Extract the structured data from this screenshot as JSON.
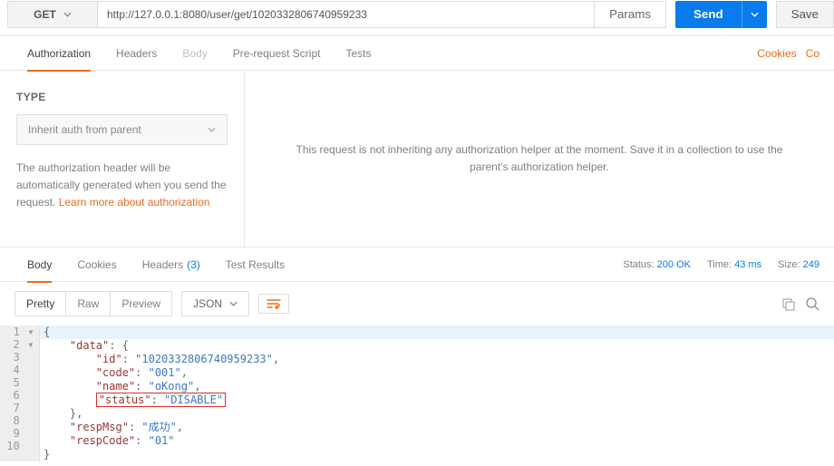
{
  "request": {
    "method": "GET",
    "url": "http://127.0.0.1:8080/user/get/1020332806740959233",
    "params_label": "Params",
    "send_label": "Send",
    "save_label": "Save"
  },
  "tabs": {
    "authorization": "Authorization",
    "headers": "Headers",
    "body": "Body",
    "prerequest": "Pre-request Script",
    "tests": "Tests",
    "cookies_link": "Cookies",
    "code_link": "Co"
  },
  "auth": {
    "type_label": "TYPE",
    "selected": "Inherit auth from parent",
    "help_prefix": "The authorization header will be automatically generated when you send the request. ",
    "help_link": "Learn more about authorization",
    "right_msg": "This request is not inheriting any authorization helper at the moment. Save it in a collection to use the parent's authorization helper."
  },
  "response_tabs": {
    "body": "Body",
    "cookies": "Cookies",
    "headers": "Headers",
    "headers_count": "(3)",
    "test_results": "Test Results"
  },
  "status": {
    "status_label": "Status:",
    "status_value": "200 OK",
    "time_label": "Time:",
    "time_value": "43 ms",
    "size_label": "Size:",
    "size_value": "249"
  },
  "viewbar": {
    "pretty": "Pretty",
    "raw": "Raw",
    "preview": "Preview",
    "format": "JSON"
  },
  "response_body": {
    "lines": [
      {
        "n": 1,
        "indent": 0,
        "fold": true,
        "tokens": [
          {
            "t": "punc",
            "v": "{"
          }
        ]
      },
      {
        "n": 2,
        "indent": 1,
        "fold": true,
        "tokens": [
          {
            "t": "key",
            "v": "\"data\""
          },
          {
            "t": "punc",
            "v": ": {"
          }
        ]
      },
      {
        "n": 3,
        "indent": 2,
        "tokens": [
          {
            "t": "key",
            "v": "\"id\""
          },
          {
            "t": "punc",
            "v": ": "
          },
          {
            "t": "str",
            "v": "\"1020332806740959233\""
          },
          {
            "t": "punc",
            "v": ","
          }
        ]
      },
      {
        "n": 4,
        "indent": 2,
        "tokens": [
          {
            "t": "key",
            "v": "\"code\""
          },
          {
            "t": "punc",
            "v": ": "
          },
          {
            "t": "str",
            "v": "\"001\""
          },
          {
            "t": "punc",
            "v": ","
          }
        ]
      },
      {
        "n": 5,
        "indent": 2,
        "tokens": [
          {
            "t": "key",
            "v": "\"name\""
          },
          {
            "t": "punc",
            "v": ": "
          },
          {
            "t": "str",
            "v": "\"oKong\""
          },
          {
            "t": "punc",
            "v": ","
          }
        ]
      },
      {
        "n": 6,
        "indent": 2,
        "hl": true,
        "tokens": [
          {
            "t": "key",
            "v": "\"status\""
          },
          {
            "t": "punc",
            "v": ": "
          },
          {
            "t": "str",
            "v": "\"DISABLE\""
          }
        ]
      },
      {
        "n": 7,
        "indent": 1,
        "tokens": [
          {
            "t": "punc",
            "v": "},"
          }
        ]
      },
      {
        "n": 8,
        "indent": 1,
        "tokens": [
          {
            "t": "key",
            "v": "\"respMsg\""
          },
          {
            "t": "punc",
            "v": ": "
          },
          {
            "t": "str",
            "v": "\"成功\""
          },
          {
            "t": "punc",
            "v": ","
          }
        ]
      },
      {
        "n": 9,
        "indent": 1,
        "tokens": [
          {
            "t": "key",
            "v": "\"respCode\""
          },
          {
            "t": "punc",
            "v": ": "
          },
          {
            "t": "str",
            "v": "\"01\""
          }
        ]
      },
      {
        "n": 10,
        "indent": 0,
        "tokens": [
          {
            "t": "punc",
            "v": "}"
          }
        ]
      }
    ]
  }
}
